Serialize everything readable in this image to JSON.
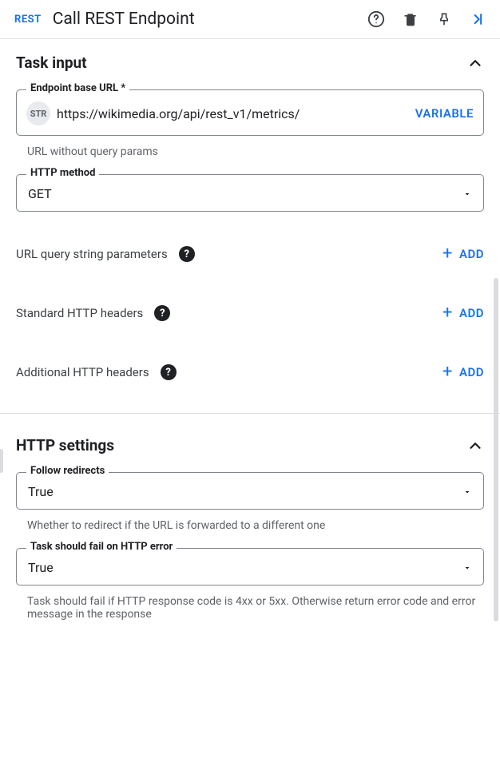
{
  "header": {
    "badge": "REST",
    "title": "Call REST Endpoint"
  },
  "taskInput": {
    "sectionTitle": "Task input",
    "endpointUrl": {
      "label": "Endpoint base URL *",
      "typeBadge": "STR",
      "value": "https://wikimedia.org/api/rest_v1/metrics/",
      "variableButton": "VARIABLE",
      "helper": "URL without query params"
    },
    "httpMethod": {
      "label": "HTTP method",
      "value": "GET"
    },
    "rows": [
      {
        "label": "URL query string parameters",
        "addLabel": "ADD"
      },
      {
        "label": "Standard HTTP headers",
        "addLabel": "ADD"
      },
      {
        "label": "Additional HTTP headers",
        "addLabel": "ADD"
      }
    ]
  },
  "httpSettings": {
    "sectionTitle": "HTTP settings",
    "followRedirects": {
      "label": "Follow redirects",
      "value": "True",
      "helper": "Whether to redirect if the URL is forwarded to a different one"
    },
    "failOnError": {
      "label": "Task should fail on HTTP error",
      "value": "True",
      "helper": "Task should fail if HTTP response code is 4xx or 5xx. Otherwise return error code and error message in the response"
    }
  }
}
